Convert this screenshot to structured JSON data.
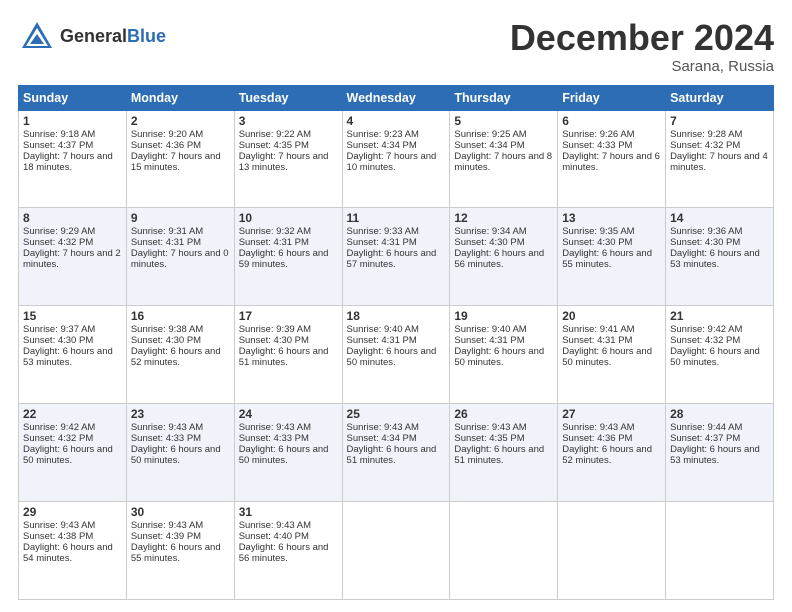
{
  "header": {
    "logo_general": "General",
    "logo_blue": "Blue",
    "month_title": "December 2024",
    "location": "Sarana, Russia"
  },
  "weekdays": [
    "Sunday",
    "Monday",
    "Tuesday",
    "Wednesday",
    "Thursday",
    "Friday",
    "Saturday"
  ],
  "weeks": [
    [
      {
        "day": "1",
        "sunrise": "9:18 AM",
        "sunset": "4:37 PM",
        "daylight": "7 hours and 18 minutes."
      },
      {
        "day": "2",
        "sunrise": "9:20 AM",
        "sunset": "4:36 PM",
        "daylight": "7 hours and 15 minutes."
      },
      {
        "day": "3",
        "sunrise": "9:22 AM",
        "sunset": "4:35 PM",
        "daylight": "7 hours and 13 minutes."
      },
      {
        "day": "4",
        "sunrise": "9:23 AM",
        "sunset": "4:34 PM",
        "daylight": "7 hours and 10 minutes."
      },
      {
        "day": "5",
        "sunrise": "9:25 AM",
        "sunset": "4:34 PM",
        "daylight": "7 hours and 8 minutes."
      },
      {
        "day": "6",
        "sunrise": "9:26 AM",
        "sunset": "4:33 PM",
        "daylight": "7 hours and 6 minutes."
      },
      {
        "day": "7",
        "sunrise": "9:28 AM",
        "sunset": "4:32 PM",
        "daylight": "7 hours and 4 minutes."
      }
    ],
    [
      {
        "day": "8",
        "sunrise": "9:29 AM",
        "sunset": "4:32 PM",
        "daylight": "7 hours and 2 minutes."
      },
      {
        "day": "9",
        "sunrise": "9:31 AM",
        "sunset": "4:31 PM",
        "daylight": "7 hours and 0 minutes."
      },
      {
        "day": "10",
        "sunrise": "9:32 AM",
        "sunset": "4:31 PM",
        "daylight": "6 hours and 59 minutes."
      },
      {
        "day": "11",
        "sunrise": "9:33 AM",
        "sunset": "4:31 PM",
        "daylight": "6 hours and 57 minutes."
      },
      {
        "day": "12",
        "sunrise": "9:34 AM",
        "sunset": "4:30 PM",
        "daylight": "6 hours and 56 minutes."
      },
      {
        "day": "13",
        "sunrise": "9:35 AM",
        "sunset": "4:30 PM",
        "daylight": "6 hours and 55 minutes."
      },
      {
        "day": "14",
        "sunrise": "9:36 AM",
        "sunset": "4:30 PM",
        "daylight": "6 hours and 53 minutes."
      }
    ],
    [
      {
        "day": "15",
        "sunrise": "9:37 AM",
        "sunset": "4:30 PM",
        "daylight": "6 hours and 53 minutes."
      },
      {
        "day": "16",
        "sunrise": "9:38 AM",
        "sunset": "4:30 PM",
        "daylight": "6 hours and 52 minutes."
      },
      {
        "day": "17",
        "sunrise": "9:39 AM",
        "sunset": "4:30 PM",
        "daylight": "6 hours and 51 minutes."
      },
      {
        "day": "18",
        "sunrise": "9:40 AM",
        "sunset": "4:31 PM",
        "daylight": "6 hours and 50 minutes."
      },
      {
        "day": "19",
        "sunrise": "9:40 AM",
        "sunset": "4:31 PM",
        "daylight": "6 hours and 50 minutes."
      },
      {
        "day": "20",
        "sunrise": "9:41 AM",
        "sunset": "4:31 PM",
        "daylight": "6 hours and 50 minutes."
      },
      {
        "day": "21",
        "sunrise": "9:42 AM",
        "sunset": "4:32 PM",
        "daylight": "6 hours and 50 minutes."
      }
    ],
    [
      {
        "day": "22",
        "sunrise": "9:42 AM",
        "sunset": "4:32 PM",
        "daylight": "6 hours and 50 minutes."
      },
      {
        "day": "23",
        "sunrise": "9:43 AM",
        "sunset": "4:33 PM",
        "daylight": "6 hours and 50 minutes."
      },
      {
        "day": "24",
        "sunrise": "9:43 AM",
        "sunset": "4:33 PM",
        "daylight": "6 hours and 50 minutes."
      },
      {
        "day": "25",
        "sunrise": "9:43 AM",
        "sunset": "4:34 PM",
        "daylight": "6 hours and 51 minutes."
      },
      {
        "day": "26",
        "sunrise": "9:43 AM",
        "sunset": "4:35 PM",
        "daylight": "6 hours and 51 minutes."
      },
      {
        "day": "27",
        "sunrise": "9:43 AM",
        "sunset": "4:36 PM",
        "daylight": "6 hours and 52 minutes."
      },
      {
        "day": "28",
        "sunrise": "9:44 AM",
        "sunset": "4:37 PM",
        "daylight": "6 hours and 53 minutes."
      }
    ],
    [
      {
        "day": "29",
        "sunrise": "9:43 AM",
        "sunset": "4:38 PM",
        "daylight": "6 hours and 54 minutes."
      },
      {
        "day": "30",
        "sunrise": "9:43 AM",
        "sunset": "4:39 PM",
        "daylight": "6 hours and 55 minutes."
      },
      {
        "day": "31",
        "sunrise": "9:43 AM",
        "sunset": "4:40 PM",
        "daylight": "6 hours and 56 minutes."
      },
      null,
      null,
      null,
      null
    ]
  ]
}
